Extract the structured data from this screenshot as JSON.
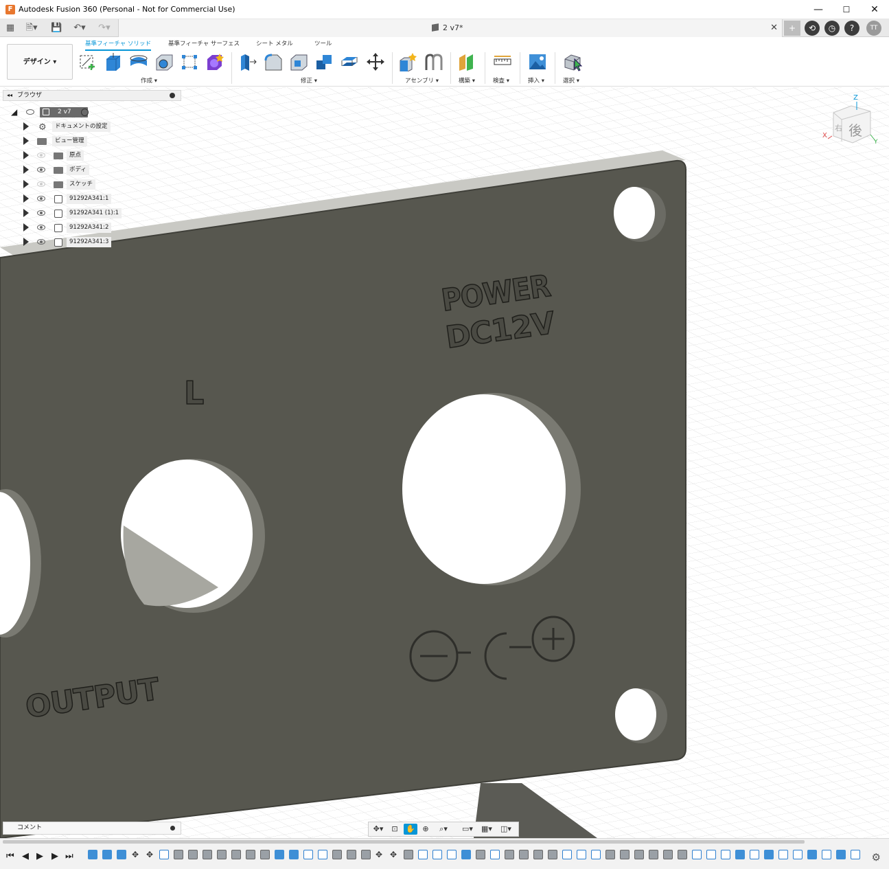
{
  "window": {
    "title": "Autodesk Fusion 360 (Personal - Not for Commercial Use)",
    "logo": "F",
    "minimize": "—",
    "maximize": "☐",
    "close": "✕"
  },
  "tabbar": {
    "doc_name": "2 v7*",
    "close": "✕",
    "plus": "+",
    "user_initials": "TT",
    "help": "?"
  },
  "toolbar": {
    "workspace": "デザイン ▾",
    "tabs": [
      "基準フィーチャ ソリッド",
      "基準フィーチャ サーフェス",
      "シート メタル",
      "ツール"
    ],
    "groups": [
      "作成 ▾",
      "修正 ▾",
      "アセンブリ ▾",
      "構築 ▾",
      "検査 ▾",
      "挿入 ▾",
      "選択 ▾"
    ]
  },
  "browser": {
    "title": "ブラウザ",
    "root": "2 v7",
    "items": [
      {
        "label": "ドキュメントの設定",
        "icon": "gear-icon",
        "visible": true
      },
      {
        "label": "ビュー管理",
        "icon": "folder-icon",
        "visible": true
      },
      {
        "label": "原点",
        "icon": "folder-icon",
        "visible": false
      },
      {
        "label": "ボディ",
        "icon": "folder-icon",
        "visible": true
      },
      {
        "label": "スケッチ",
        "icon": "folder-icon",
        "visible": false
      },
      {
        "label": "91292A341:1",
        "icon": "component-icon",
        "visible": true
      },
      {
        "label": "91292A341 (1):1",
        "icon": "component-icon",
        "visible": true
      },
      {
        "label": "91292A341:2",
        "icon": "component-icon",
        "visible": true
      },
      {
        "label": "91292A341:3",
        "icon": "component-icon",
        "visible": true
      }
    ]
  },
  "viewport": {
    "engravings": {
      "power": "POWER",
      "voltage": "DC12V",
      "left": "L",
      "output": "OUTPUT"
    },
    "viewcube": {
      "face": "後",
      "face_side": "右",
      "axis_x": "X",
      "axis_y": "Y",
      "axis_z": "Z"
    },
    "colors": {
      "panel": "#57574f",
      "panel_edge": "#3f3f39",
      "grid": "#d7d7d7",
      "accent": "#0696d7"
    }
  },
  "comment": {
    "label": "コメント"
  },
  "navbar": {
    "items": [
      "orbit-icon",
      "look-at-icon",
      "pan-icon",
      "zoom-icon",
      "fit-icon",
      "display-icon",
      "grid-icon",
      "viewports-icon"
    ]
  },
  "timeline": {
    "controls": [
      "⏮",
      "◀",
      "▶",
      "▶",
      "⏭"
    ],
    "settings": "⚙"
  }
}
